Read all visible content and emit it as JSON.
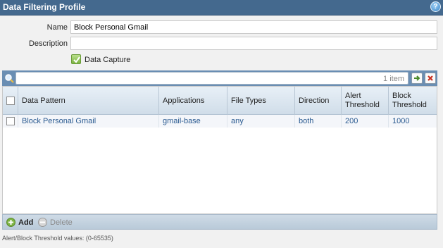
{
  "window": {
    "title": "Data Filtering Profile",
    "help_label": "?"
  },
  "form": {
    "name_label": "Name",
    "name_value": "Block Personal Gmail",
    "description_label": "Description",
    "description_value": "",
    "data_capture_label": "Data Capture",
    "data_capture_checked": true
  },
  "search": {
    "placeholder": "",
    "count": "1 item"
  },
  "table": {
    "columns": [
      "Data Pattern",
      "Applications",
      "File Types",
      "Direction",
      "Alert Threshold",
      "Block Threshold"
    ],
    "rows": [
      {
        "data_pattern": "Block Personal Gmail",
        "applications": "gmail-base",
        "file_types": "any",
        "direction": "both",
        "alert_threshold": "200",
        "block_threshold": "1000"
      }
    ]
  },
  "footer": {
    "add_label": "Add",
    "delete_label": "Delete"
  },
  "hint": "Alert/Block Threshold values: (0-65535)",
  "colors": {
    "titlebar": "#44698e",
    "toolbar": "#6a8eb3",
    "accent_green": "#7cb342",
    "link_text": "#2a5a90"
  }
}
